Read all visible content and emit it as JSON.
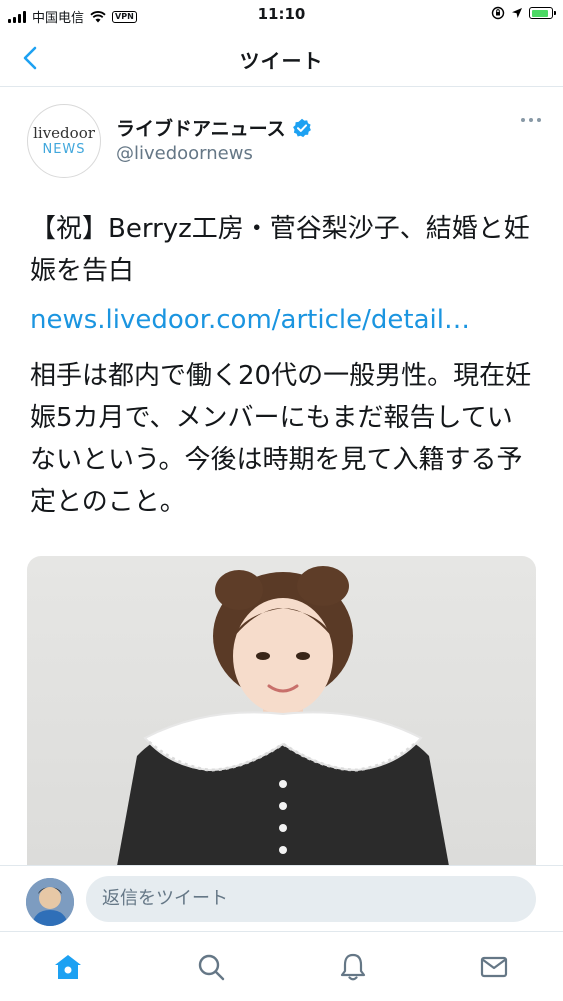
{
  "status_bar": {
    "carrier": "中国电信",
    "vpn": "VPN",
    "time": "11:10"
  },
  "nav": {
    "title": "ツイート"
  },
  "tweet": {
    "avatar_line1": "livedoor",
    "avatar_line2": "NEWS",
    "user_name": "ライブドアニュース",
    "handle": "@livedoornews",
    "text": "【祝】Berryz工房・菅谷梨沙子、結婚と妊娠を告白",
    "link": "news.livedoor.com/article/detail…",
    "text2": "相手は都内で働く20代の一般男性。現在妊娠5カ月で、メンバーにもまだ報告していないという。今後は時期を見て入籍する予定とのこと。"
  },
  "reply": {
    "placeholder": "返信をツイート"
  },
  "colors": {
    "accent": "#1da1f2",
    "link": "#1b95e0",
    "secondary_text": "#657786",
    "battery": "#4cd964"
  },
  "icons": {
    "back": "chevron-left-icon",
    "verified": "verified-badge-icon",
    "more": "more-horizontal-icon",
    "home": "home-icon",
    "search": "search-icon",
    "notifications": "bell-icon",
    "messages": "mail-icon"
  }
}
